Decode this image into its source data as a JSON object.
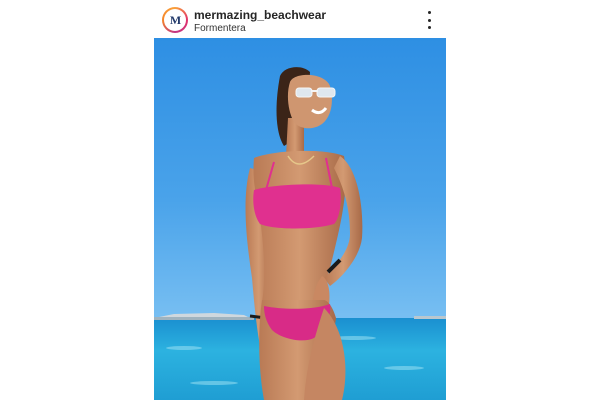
{
  "post": {
    "avatar_text": "M",
    "username": "mermazing_beachwear",
    "location": "Formentera",
    "more_icon": "more-vertical-icon"
  },
  "photo": {
    "subject": "woman-in-pink-bikini",
    "sky_color": "#3f9de8",
    "sea_color": "#2aa4d8",
    "bikini_color": "#e0308f"
  }
}
